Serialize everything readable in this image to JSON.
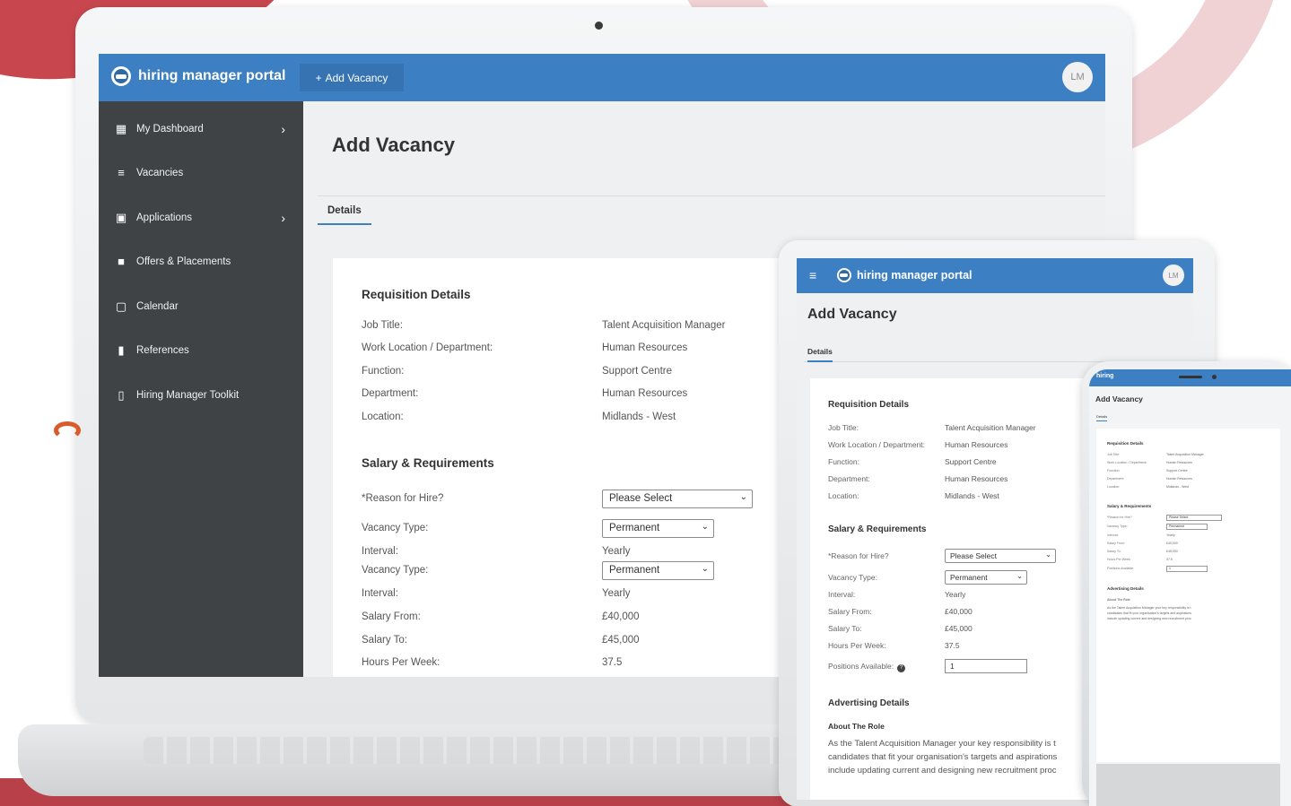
{
  "brand": {
    "name": "hiring manager portal",
    "short": "hiring"
  },
  "topbar": {
    "add_vacancy_label": "Add Vacancy",
    "add_icon": "+",
    "avatar_initials": "LM"
  },
  "colors": {
    "primary": "#3d7fc3",
    "sidebar": "#3f4346",
    "background_accent": "#c8474f"
  },
  "sidebar": {
    "items": [
      {
        "label": "My Dashboard",
        "icon": "dashboard-icon",
        "has_chevron": true
      },
      {
        "label": "Vacancies",
        "icon": "list-icon",
        "has_chevron": false
      },
      {
        "label": "Applications",
        "icon": "badge-icon",
        "has_chevron": true
      },
      {
        "label": "Offers & Placements",
        "icon": "briefcase-icon",
        "has_chevron": false
      },
      {
        "label": "Calendar",
        "icon": "calendar-icon",
        "has_chevron": false
      },
      {
        "label": "References",
        "icon": "contact-card-icon",
        "has_chevron": false
      },
      {
        "label": "Hiring Manager Toolkit",
        "icon": "book-icon",
        "has_chevron": false
      }
    ]
  },
  "page": {
    "title": "Add Vacancy",
    "tabs": [
      {
        "label": "Details"
      }
    ]
  },
  "requisition": {
    "title": "Requisition Details",
    "rows": [
      {
        "label": "Job Title:",
        "value": "Talent Acquisition Manager"
      },
      {
        "label": "Work Location / Department:",
        "value": "Human Resources"
      },
      {
        "label": "Function:",
        "value": "Support Centre"
      },
      {
        "label": "Department:",
        "value": "Human Resources"
      },
      {
        "label": "Location:",
        "value": "Midlands - West"
      }
    ]
  },
  "salary": {
    "title": "Salary & Requirements",
    "reason_label": "*Reason for Hire?",
    "reason_value": "Please Select",
    "vacancy_type_label": "Vacancy Type:",
    "vacancy_type_value": "Permanent",
    "interval_label": "Interval:",
    "interval_value": "Yearly",
    "salary_from_label": "Salary From:",
    "salary_from_value": "£40,000",
    "salary_to_label": "Salary To:",
    "salary_to_value": "£45,000",
    "hours_label": "Hours Per Week:",
    "hours_value": "37.5",
    "positions_label": "Positions Available:",
    "positions_value": "1"
  },
  "advertising": {
    "title": "Advertising Details",
    "about_label": "About The Role",
    "about_text_1": "As the Talent Acquisition Manager your key responsibility is t",
    "about_text_2": "candidates that fit your organisation's targets and aspirations",
    "about_text_3": "include updating current and designing new recruitment proc"
  }
}
